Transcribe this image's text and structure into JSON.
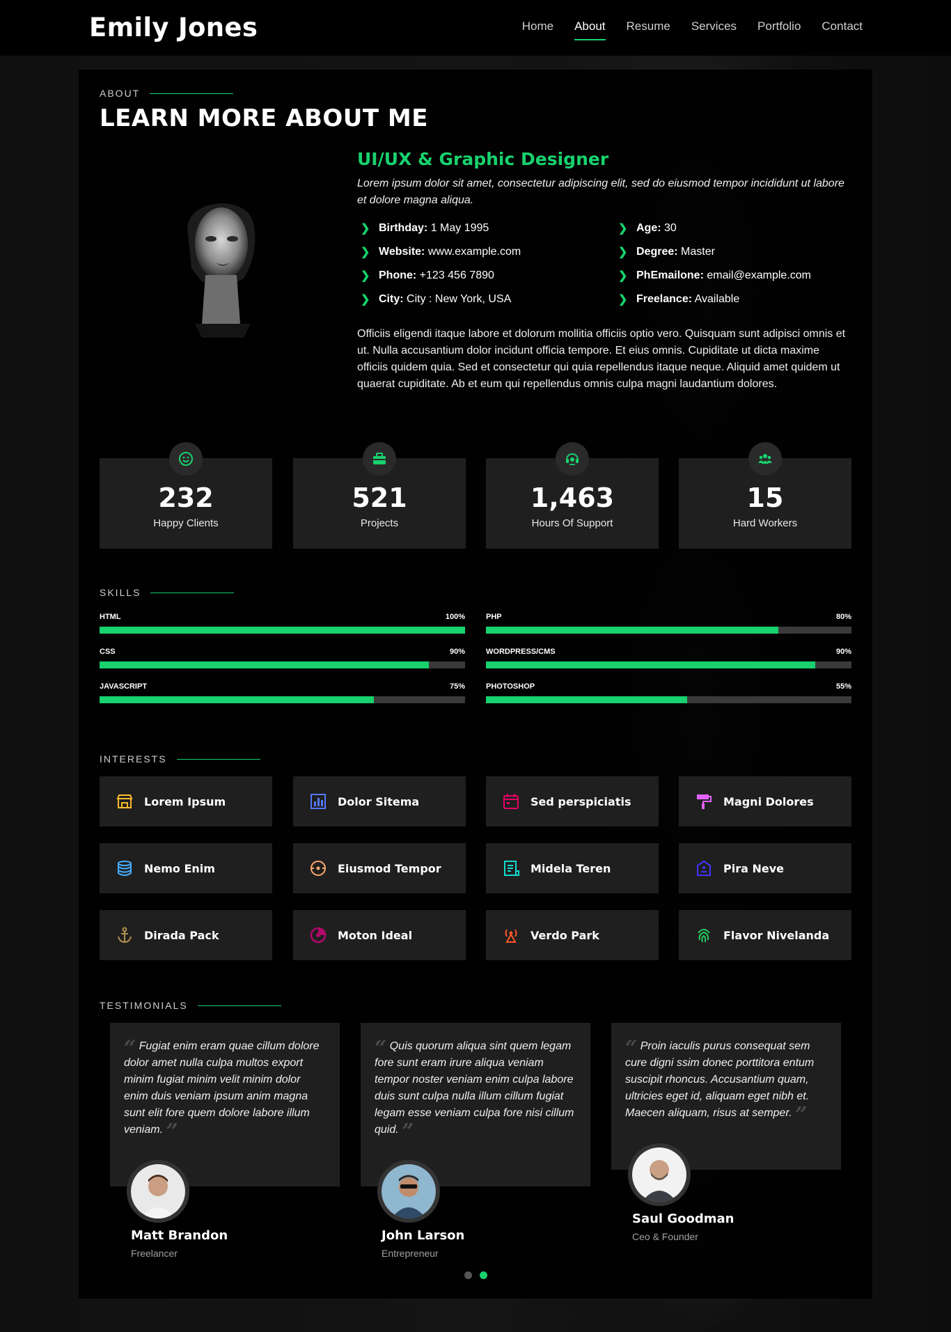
{
  "header": {
    "logo": "Emily Jones",
    "nav": [
      "Home",
      "About",
      "Resume",
      "Services",
      "Portfolio",
      "Contact"
    ],
    "active_nav": "About"
  },
  "about": {
    "label": "ABOUT",
    "title": "LEARN MORE ABOUT ME",
    "role": "UI/UX & Graphic Designer",
    "intro": "Lorem ipsum dolor sit amet, consectetur adipiscing elit, sed do eiusmod tempor incididunt ut labore et dolore magna aliqua.",
    "facts_left": [
      {
        "label": "Birthday:",
        "value": "1 May 1995"
      },
      {
        "label": "Website:",
        "value": "www.example.com"
      },
      {
        "label": "Phone:",
        "value": "+123 456 7890"
      },
      {
        "label": "City:",
        "value": "City : New York, USA"
      }
    ],
    "facts_right": [
      {
        "label": "Age:",
        "value": "30"
      },
      {
        "label": "Degree:",
        "value": "Master"
      },
      {
        "label": "PhEmailone:",
        "value": "email@example.com"
      },
      {
        "label": "Freelance:",
        "value": "Available"
      }
    ],
    "description": "Officiis eligendi itaque labore et dolorum mollitia officiis optio vero. Quisquam sunt adipisci omnis et ut. Nulla accusantium dolor incidunt officia tempore. Et eius omnis. Cupiditate ut dicta maxime officiis quidem quia. Sed et consectetur qui quia repellendus itaque neque. Aliquid amet quidem ut quaerat cupiditate. Ab et eum qui repellendus omnis culpa magni laudantium dolores."
  },
  "stats": [
    {
      "value": "232",
      "label": "Happy Clients",
      "icon": "smiley-icon"
    },
    {
      "value": "521",
      "label": "Projects",
      "icon": "briefcase-icon"
    },
    {
      "value": "1,463",
      "label": "Hours Of Support",
      "icon": "headset-icon"
    },
    {
      "value": "15",
      "label": "Hard Workers",
      "icon": "people-icon"
    }
  ],
  "skills": {
    "label": "SKILLS",
    "items": [
      {
        "name": "HTML",
        "percent_label": "100%",
        "percent": 100
      },
      {
        "name": "PHP",
        "percent_label": "80%",
        "percent": 80
      },
      {
        "name": "CSS",
        "percent_label": "90%",
        "percent": 90
      },
      {
        "name": "WORDPRESS/CMS",
        "percent_label": "90%",
        "percent": 90
      },
      {
        "name": "JAVASCRIPT",
        "percent_label": "75%",
        "percent": 75
      },
      {
        "name": "PHOTOSHOP",
        "percent_label": "55%",
        "percent": 55
      }
    ]
  },
  "interests": {
    "label": "INTERESTS",
    "items": [
      {
        "name": "Lorem Ipsum",
        "icon": "store-icon",
        "color": "#ffbb2c"
      },
      {
        "name": "Dolor Sitema",
        "icon": "bar-chart-icon",
        "color": "#5578ff"
      },
      {
        "name": "Sed perspiciatis",
        "icon": "calendar-icon",
        "color": "#e80368"
      },
      {
        "name": "Magni Dolores",
        "icon": "paint-roller-icon",
        "color": "#e361ff"
      },
      {
        "name": "Nemo Enim",
        "icon": "database-icon",
        "color": "#47aeff"
      },
      {
        "name": "Eiusmod Tempor",
        "icon": "gradienter-icon",
        "color": "#ffa76e"
      },
      {
        "name": "Midela Teren",
        "icon": "file-list-icon",
        "color": "#11dbcf"
      },
      {
        "name": "Pira Neve",
        "icon": "price-tag-icon",
        "color": "#4233ff"
      },
      {
        "name": "Dirada Pack",
        "icon": "anchor-icon",
        "color": "#b2904f"
      },
      {
        "name": "Moton Ideal",
        "icon": "disc-icon",
        "color": "#b20969"
      },
      {
        "name": "Verdo Park",
        "icon": "base-station-icon",
        "color": "#ff5828"
      },
      {
        "name": "Flavor Nivelanda",
        "icon": "fingerprint-icon",
        "color": "#29cc61"
      }
    ]
  },
  "testimonials": {
    "label": "TESTIMONIALS",
    "items": [
      {
        "quote": "Fugiat enim eram quae cillum dolore dolor amet nulla culpa multos export minim fugiat minim velit minim dolor enim duis veniam ipsum anim magna sunt elit fore quem dolore labore illum veniam.",
        "name": "Matt Brandon",
        "role": "Freelancer"
      },
      {
        "quote": "Quis quorum aliqua sint quem legam fore sunt eram irure aliqua veniam tempor noster veniam enim culpa labore duis sunt culpa nulla illum cillum fugiat legam esse veniam culpa fore nisi cillum quid.",
        "name": "John Larson",
        "role": "Entrepreneur"
      },
      {
        "quote": "Proin iaculis purus consequat sem cure digni ssim donec porttitora entum suscipit rhoncus. Accusantium quam, ultricies eget id, aliquam eget nibh et. Maecen aliquam, risus at semper.",
        "name": "Saul Goodman",
        "role": "Ceo & Founder"
      }
    ],
    "active_page": 2,
    "pages": 2
  },
  "colors": {
    "accent": "#18d26e",
    "card": "#1f1f1f"
  }
}
